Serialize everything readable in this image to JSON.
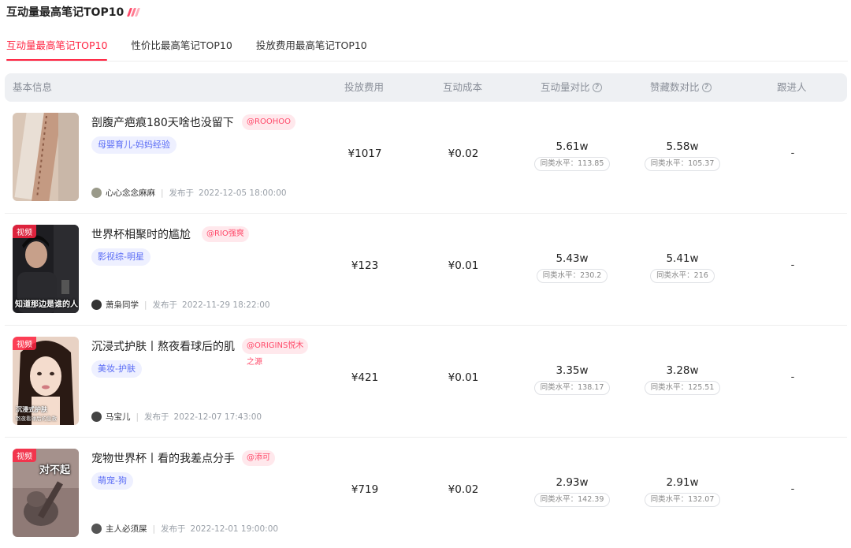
{
  "header": {
    "title": "互动量最高笔记TOP10"
  },
  "tabs": [
    {
      "label": "互动量最高笔记TOP10",
      "active": true
    },
    {
      "label": "性价比最高笔记TOP10",
      "active": false
    },
    {
      "label": "投放费用最高笔记TOP10",
      "active": false
    }
  ],
  "columns": {
    "basic": "基本信息",
    "cost": "投放费用",
    "interaction_cost": "互动成本",
    "interaction_compare": "互动量对比",
    "likes_compare": "赞藏数对比",
    "follower": "跟进人"
  },
  "rows": [
    {
      "title": "剖腹产疤痕180天啥也没留下",
      "brand": "@ROOHOO",
      "category": "母婴育儿-妈妈经验",
      "author": "心心念念麻麻",
      "published_label": "发布于",
      "published": "2022-12-05 18:00:00",
      "cost": "¥1017",
      "interaction_cost": "¥0.02",
      "interaction": "5.61w",
      "interaction_avg": "同类水平：113.85",
      "likes": "5.58w",
      "likes_avg": "同类水平：105.37",
      "follower": "-"
    },
    {
      "badge": "视频",
      "thumb_caption": "知道那边是谁的人",
      "title": "世界杯相聚时的尴尬",
      "brand": "@RIO强爽",
      "category": "影视综-明星",
      "author": "萧枭同学",
      "published_label": "发布于",
      "published": "2022-11-29 18:22:00",
      "cost": "¥123",
      "interaction_cost": "¥0.01",
      "interaction": "5.43w",
      "interaction_avg": "同类水平：230.2",
      "likes": "5.41w",
      "likes_avg": "同类水平：216",
      "follower": "-"
    },
    {
      "badge": "视频",
      "thumb_caption": "沉浸式护肤",
      "thumb_caption_small": "熬夜看球后的急救",
      "title": "沉浸式护肤丨熬夜看球后的肌",
      "brand": "@ORIGINS悦木",
      "brand_line2": "之源",
      "category": "美妆-护肤",
      "author": "马宝儿",
      "published_label": "发布于",
      "published": "2022-12-07 17:43:00",
      "cost": "¥421",
      "interaction_cost": "¥0.01",
      "interaction": "3.35w",
      "interaction_avg": "同类水平：138.17",
      "likes": "3.28w",
      "likes_avg": "同类水平：125.51",
      "follower": "-"
    },
    {
      "badge": "视频",
      "thumb_caption": "对不起",
      "title": "宠物世界杯丨看的我差点分手",
      "brand": "@添可",
      "category": "萌宠-狗",
      "author": "主人必须屎",
      "published_label": "发布于",
      "published": "2022-12-01 19:00:00",
      "cost": "¥719",
      "interaction_cost": "¥0.02",
      "interaction": "2.93w",
      "interaction_avg": "同类水平：142.39",
      "likes": "2.91w",
      "likes_avg": "同类水平：132.07",
      "follower": "-"
    }
  ],
  "colors": {
    "accent": "#ff2442",
    "tag_blue": "#5a6cf5",
    "header_bg": "#eef0f3"
  }
}
